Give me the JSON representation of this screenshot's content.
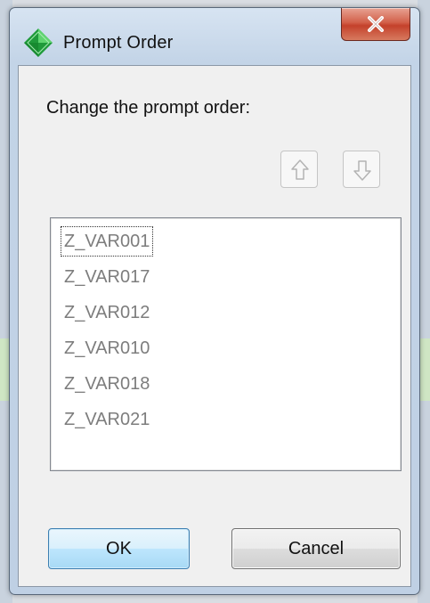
{
  "window": {
    "title": "Prompt Order"
  },
  "instruction": "Change the prompt order:",
  "list": {
    "items": [
      "Z_VAR001",
      "Z_VAR017",
      "Z_VAR012",
      "Z_VAR010",
      "Z_VAR018",
      "Z_VAR021"
    ],
    "focused_index": 0
  },
  "buttons": {
    "ok_label": "OK",
    "cancel_label": "Cancel"
  },
  "icons": {
    "app": "green-diamond-icon",
    "close": "close-icon",
    "move_up": "arrow-up-icon",
    "move_down": "arrow-down-icon"
  },
  "colors": {
    "close_button": "#c4412b",
    "ok_button_border": "#3c7fb1",
    "list_text": "#7d7d7d",
    "app_icon": "#2db34a"
  }
}
